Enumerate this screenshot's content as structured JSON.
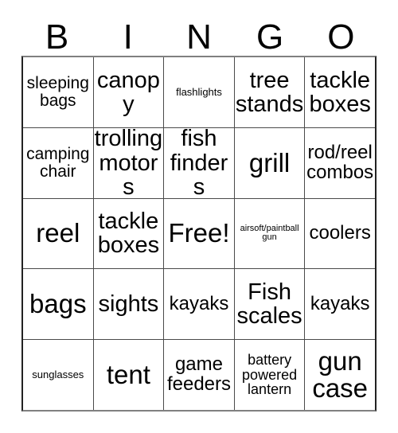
{
  "card": {
    "title": "BINGO",
    "header_letters": [
      "B",
      "I",
      "N",
      "G",
      "O"
    ],
    "free_space_label": "Free!",
    "colors": {
      "background": "#ffffff",
      "text": "#000000",
      "grid_line": "#4a4a4a",
      "outer_border": "#222222"
    },
    "rows": [
      [
        {
          "text": "sleeping bags",
          "size": "fs-lg"
        },
        {
          "text": "canopy",
          "size": "fs-xxl"
        },
        {
          "text": "flashlights",
          "size": "fs-sm"
        },
        {
          "text": "tree stands",
          "size": "fs-xxl"
        },
        {
          "text": "tackle boxes",
          "size": "fs-xxl"
        }
      ],
      [
        {
          "text": "camping chair",
          "size": "fs-lg"
        },
        {
          "text": "trolling motors",
          "size": "fs-xxl"
        },
        {
          "text": "fish finders",
          "size": "fs-xxl"
        },
        {
          "text": "grill",
          "size": "fs-huge"
        },
        {
          "text": "rod/reel combos",
          "size": "fs-xl"
        }
      ],
      [
        {
          "text": "reel",
          "size": "fs-huge"
        },
        {
          "text": "tackle boxes",
          "size": "fs-xxl"
        },
        {
          "text": "Free!",
          "size": "fs-huge"
        },
        {
          "text": "airsoft/paintball gun",
          "size": "fs-xs"
        },
        {
          "text": "coolers",
          "size": "fs-xl"
        }
      ],
      [
        {
          "text": "bags",
          "size": "fs-huge"
        },
        {
          "text": "sights",
          "size": "fs-xxl"
        },
        {
          "text": "kayaks",
          "size": "fs-xl"
        },
        {
          "text": "Fish scales",
          "size": "fs-xxl"
        },
        {
          "text": "kayaks",
          "size": "fs-xl"
        }
      ],
      [
        {
          "text": "sunglasses",
          "size": "fs-sm"
        },
        {
          "text": "tent",
          "size": "fs-huge"
        },
        {
          "text": "game feeders",
          "size": "fs-xl"
        },
        {
          "text": "battery powered lantern",
          "size": "fs-md"
        },
        {
          "text": "gun case",
          "size": "fs-huge"
        }
      ]
    ]
  }
}
